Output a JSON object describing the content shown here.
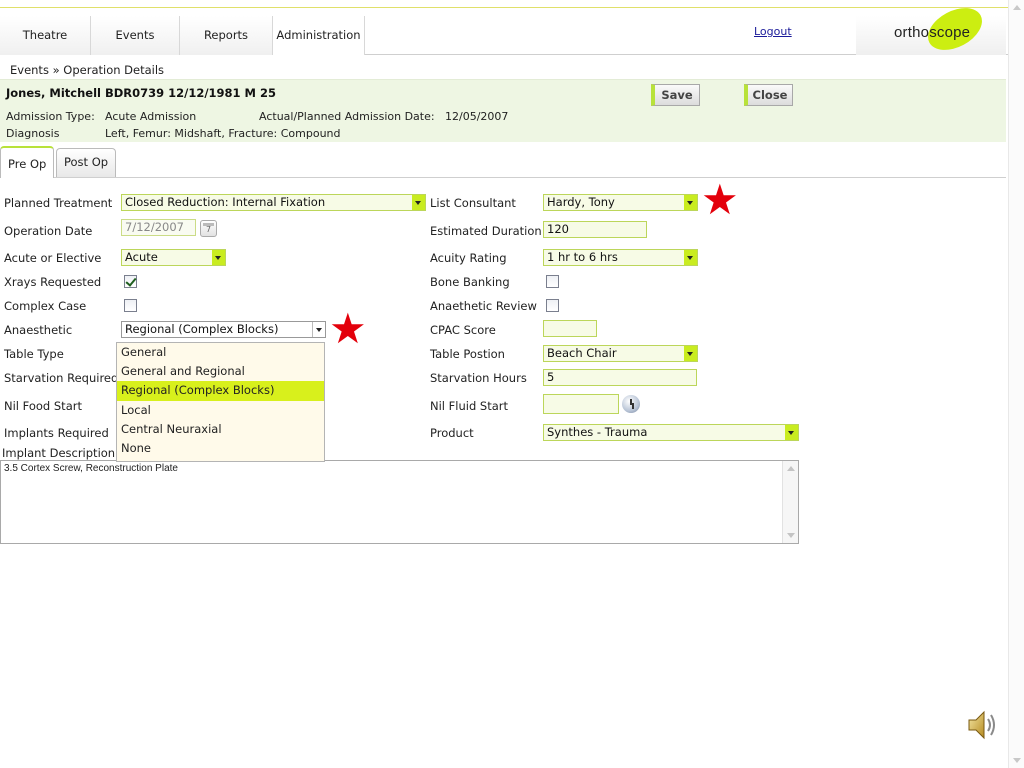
{
  "nav": {
    "tabs": [
      "Theatre",
      "Events",
      "Reports",
      "Administration"
    ],
    "logout": "Logout",
    "logo": "orthoscope"
  },
  "breadcrumb": "Events » Operation Details",
  "patient": {
    "name_line": "Jones, Mitchell BDR0739 12/12/1981 M 25",
    "admission_type_label": "Admission Type:",
    "admission_type": "Acute Admission",
    "admission_date_label": "Actual/Planned Admission Date:",
    "admission_date": "12/05/2007",
    "diagnosis_label": "Diagnosis",
    "diagnosis": "Left, Femur: Midshaft, Fracture: Compound"
  },
  "buttons": {
    "save": "Save",
    "close": "Close"
  },
  "subtabs": [
    "Pre Op",
    "Post Op"
  ],
  "form": {
    "planned_treatment": {
      "label": "Planned Treatment",
      "value": "Closed Reduction: Internal Fixation"
    },
    "operation_date": {
      "label": "Operation Date",
      "value": "7/12/2007"
    },
    "acute_or_elective": {
      "label": "Acute or Elective",
      "value": "Acute"
    },
    "xrays_requested": {
      "label": "Xrays Requested",
      "checked": true
    },
    "complex_case": {
      "label": "Complex Case",
      "checked": false
    },
    "anaesthetic": {
      "label": "Anaesthetic",
      "value": "Regional (Complex Blocks)",
      "options": [
        "General",
        "General and Regional",
        "Regional (Complex Blocks)",
        "Local",
        "Central Neuraxial",
        "None"
      ],
      "selected_index": 2
    },
    "table_type": {
      "label": "Table Type"
    },
    "starvation_required": {
      "label": "Starvation Required"
    },
    "nil_food_start": {
      "label": "Nil Food Start"
    },
    "implants_required": {
      "label": "Implants Required"
    },
    "implant_description": {
      "label": "Implant Description",
      "value": "3.5 Cortex Screw, Reconstruction Plate"
    },
    "list_consultant": {
      "label": "List Consultant",
      "value": "Hardy, Tony"
    },
    "estimated_duration": {
      "label": "Estimated Duration",
      "value": "120"
    },
    "acuity_rating": {
      "label": "Acuity Rating",
      "value": "1 hr to 6 hrs"
    },
    "bone_banking": {
      "label": "Bone Banking",
      "checked": false
    },
    "anaethetic_review": {
      "label": "Anaethetic Review",
      "checked": false
    },
    "cpac_score": {
      "label": "CPAC Score",
      "value": ""
    },
    "table_position": {
      "label": "Table Postion",
      "value": "Beach Chair"
    },
    "starvation_hours": {
      "label": "Starvation Hours",
      "value": "5"
    },
    "nil_fluid_start": {
      "label": "Nil Fluid Start",
      "value": ""
    },
    "product": {
      "label": "Product",
      "value": "Synthes - Trauma"
    }
  },
  "colors": {
    "accent": "#ccee11",
    "star": "#e3000b",
    "panel_bg": "#eef6e3"
  },
  "icons": {
    "star": "★",
    "calendar": "calendar-icon",
    "clock": "clock-icon",
    "speaker": "speaker-icon"
  }
}
